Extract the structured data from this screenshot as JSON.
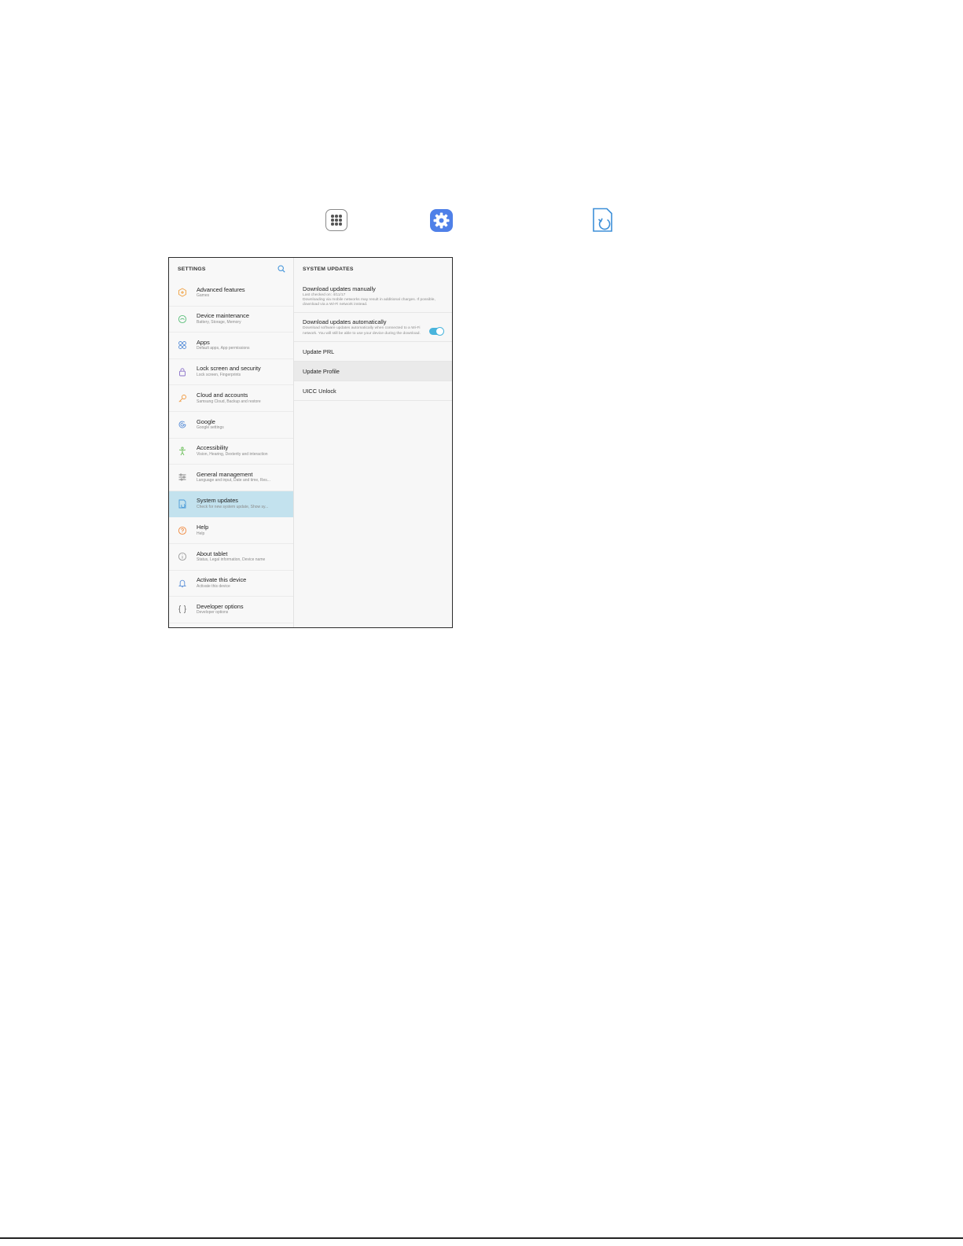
{
  "left_pane": {
    "header": "SETTINGS",
    "items": [
      {
        "title": "Advanced features",
        "sub": "Games",
        "icon": "advanced-features-icon",
        "color": "#f0a040"
      },
      {
        "title": "Device maintenance",
        "sub": "Battery, Storage, Memory",
        "icon": "device-maintenance-icon",
        "color": "#5bbf7a"
      },
      {
        "title": "Apps",
        "sub": "Default apps, App permissions",
        "icon": "apps-grid-icon",
        "color": "#5a8fd8"
      },
      {
        "title": "Lock screen and security",
        "sub": "Lock screen, Fingerprints",
        "icon": "lock-icon",
        "color": "#8a70c8"
      },
      {
        "title": "Cloud and accounts",
        "sub": "Samsung Cloud, Backup and restore",
        "icon": "key-icon",
        "color": "#f09a40"
      },
      {
        "title": "Google",
        "sub": "Google settings",
        "icon": "google-icon",
        "color": "#5a8fd8"
      },
      {
        "title": "Accessibility",
        "sub": "Vision, Hearing, Dexterity and interaction",
        "icon": "accessibility-icon",
        "color": "#6cbf5a"
      },
      {
        "title": "General management",
        "sub": "Language and input, Date and time, Res...",
        "icon": "sliders-icon",
        "color": "#8a8a8a"
      },
      {
        "title": "System updates",
        "sub": "Check for new system update, Show sy...",
        "icon": "system-updates-icon",
        "color": "#4a9ad8",
        "selected": true
      },
      {
        "title": "Help",
        "sub": "Help",
        "icon": "help-icon",
        "color": "#f08a40"
      },
      {
        "title": "About tablet",
        "sub": "Status, Legal information, Device name",
        "icon": "info-icon",
        "color": "#9a9a9a"
      },
      {
        "title": "Activate this device",
        "sub": "Activate this device",
        "icon": "bell-icon",
        "color": "#5a8fd8"
      },
      {
        "title": "Developer options",
        "sub": "Developer options",
        "icon": "braces-icon",
        "color": "#7a7a7a"
      }
    ]
  },
  "right_pane": {
    "header": "SYSTEM UPDATES",
    "download_manual": {
      "title": "Download updates manually",
      "sub": "Last checked on: 4/11/17\nDownloading via mobile networks may result in additional charges. If possible, download via a Wi-Fi network instead."
    },
    "download_auto": {
      "title": "Download updates automatically",
      "sub": "Download software updates automatically when connected to a Wi-Fi network. You will still be able to use your device during the download.",
      "toggle_on": true
    },
    "update_prl": "Update PRL",
    "update_profile": "Update Profile",
    "uicc_unlock": "UICC Unlock"
  },
  "colors": {
    "selected_bg": "#c3e2ee",
    "accent": "#49b4dc",
    "settings_icon": "#4f80e8"
  }
}
